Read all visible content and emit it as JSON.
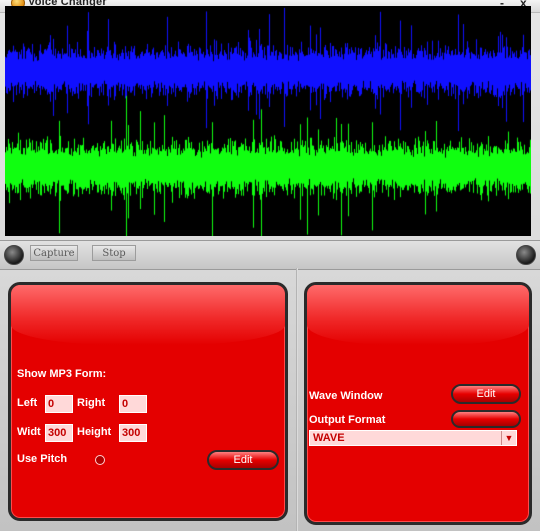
{
  "window": {
    "title": "Voice Changer",
    "minimize_label": "-",
    "close_label": "x"
  },
  "wave": {
    "colors": {
      "top_channel": "#1010ff",
      "bottom_channel": "#10ff10",
      "background": "#000000"
    }
  },
  "controls": {
    "capture_label": "Capture",
    "stop_label": "Stop"
  },
  "left_panel": {
    "heading": "Show MP3 Form:",
    "left_label": "Left",
    "left_value": "0",
    "right_label": "Right",
    "right_value": "0",
    "width_label": "Widt",
    "width_value": "300",
    "height_label": "Height",
    "height_value": "300",
    "use_pitch_label": "Use Pitch",
    "edit_label": "Edit"
  },
  "right_panel": {
    "wave_window_label": "Wave Window",
    "wave_edit_label": "Edit",
    "output_format_label": "Output Format",
    "output_format_value": "WAVE"
  },
  "colors": {
    "panel_red": "#e40000",
    "field_bg": "#ffd9d9",
    "field_text": "#c40000"
  }
}
